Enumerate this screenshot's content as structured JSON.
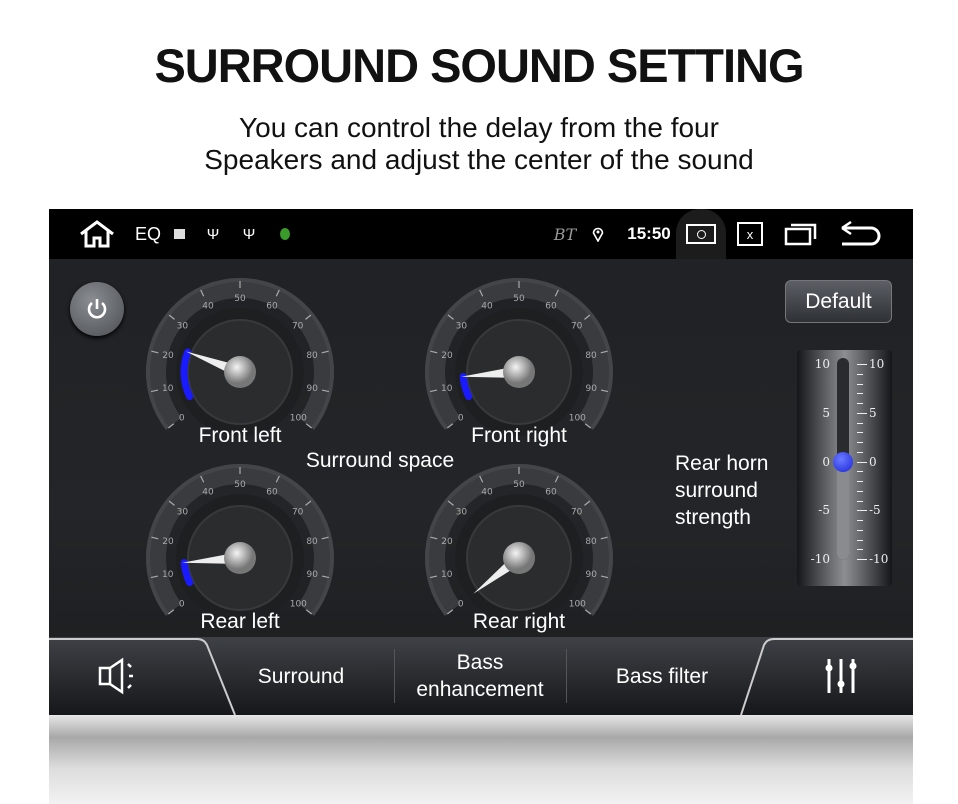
{
  "header": {
    "title": "SURROUND SOUND SETTING",
    "subtitle_line1": "You can control the delay from the four",
    "subtitle_line2": "Speakers and adjust the center of the sound"
  },
  "status_bar": {
    "eq_label": "EQ",
    "bt_label": "BT",
    "time": "15:50",
    "icons": [
      "home-icon",
      "image-icon",
      "usb-icon",
      "usb-icon",
      "android-icon",
      "bluetooth-icon",
      "location-icon",
      "screenshot-icon",
      "close-window-icon",
      "recent-apps-icon",
      "back-icon"
    ]
  },
  "controls": {
    "default_label": "Default",
    "surround_space_label": "Surround space"
  },
  "gauges": {
    "scale": [
      0,
      10,
      20,
      30,
      40,
      50,
      60,
      70,
      80,
      90,
      100
    ],
    "accent": "#1a1aff",
    "items": [
      {
        "label": "Front left",
        "value": 23
      },
      {
        "label": "Front right",
        "value": 13
      },
      {
        "label": "Rear left",
        "value": 13
      },
      {
        "label": "Rear right",
        "value": 0
      }
    ]
  },
  "rear_horn": {
    "label_line1": "Rear horn",
    "label_line2": "surround",
    "label_line3": "strength",
    "value": 0,
    "min": -10,
    "max": 10,
    "ticks": [
      "10",
      "5",
      "0",
      "-5",
      "-10"
    ]
  },
  "tabs": {
    "speaker_icon": "speaker-icon",
    "items": [
      "Surround",
      "Bass enhancement",
      "Bass filter"
    ],
    "eq_icon": "equalizer-sliders-icon"
  }
}
